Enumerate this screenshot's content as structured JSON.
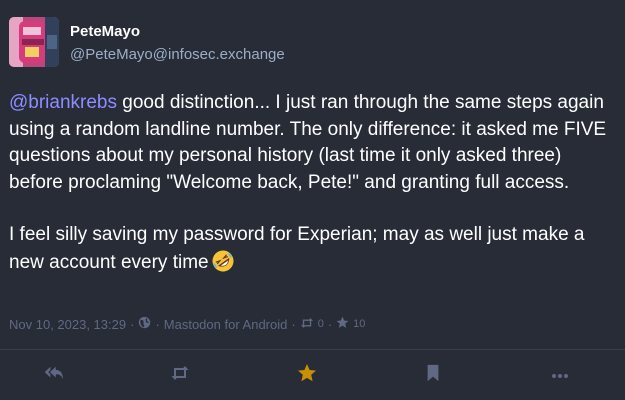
{
  "author": {
    "display_name": "PeteMayo",
    "handle": "@PeteMayo@infosec.exchange",
    "avatar_icon": "avatar-image"
  },
  "post": {
    "mention": "@briankrebs",
    "paragraph1_text": " good distinction... I just ran through the same steps again using a random landline number. The only difference: it asked me FIVE questions about my personal history (last time it only asked three) before proclaming \"Welcome back, Pete!\" and granting full access.",
    "paragraph2_text": "I feel silly saving my password for Experian; may as well just make a new account every time",
    "emoji": "rolling-on-floor-laughing-emoji"
  },
  "meta": {
    "timestamp": "Nov 10, 2023, 13:29",
    "separator": "·",
    "visibility_icon": "globe-icon",
    "application": "Mastodon for Android",
    "boosts_count": "0",
    "favourites_count": "10"
  },
  "actions": {
    "reply_icon": "reply-all-icon",
    "boost_icon": "retweet-icon",
    "favourite_icon": "star-icon",
    "bookmark_icon": "bookmark-icon",
    "more_icon": "ellipsis-icon"
  },
  "colors": {
    "background": "#282c37",
    "text": "#ffffff",
    "secondary_text": "#9baec8",
    "meta_text": "#606984",
    "mention": "#8c8dff",
    "favourited_star": "#ca8f04",
    "action_icon": "#606984"
  }
}
